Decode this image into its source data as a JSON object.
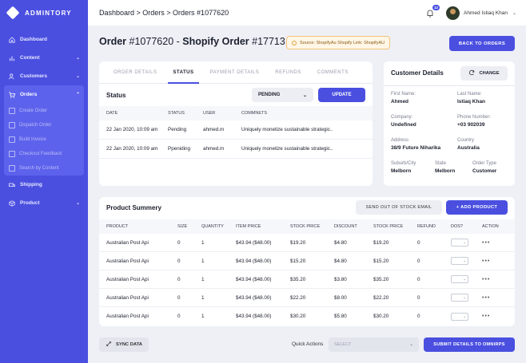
{
  "brand": {
    "name": "ADMINTORY"
  },
  "sidebar": {
    "items": [
      {
        "label": "Dashboard",
        "icon": "home-icon"
      },
      {
        "label": "Content",
        "icon": "bar-chart-icon"
      },
      {
        "label": "Customers",
        "icon": "users-icon"
      },
      {
        "label": "Orders",
        "icon": "cart-icon"
      },
      {
        "label": "Shipping",
        "icon": "truck-icon"
      },
      {
        "label": "Product",
        "icon": "box-icon"
      }
    ],
    "orders_sub": [
      "Create Order",
      "Dispatch Order",
      "Build Invoice",
      "Checkout Feedback",
      "Search by Content"
    ]
  },
  "header": {
    "breadcrumb": "Dashboard > Orders > Orders #1077620",
    "notification_count": "12",
    "user_name": "Ahmed Istiaq Khan"
  },
  "order": {
    "prefix": "Order",
    "number": "#1077620",
    "separator": "-",
    "shopify_label": "Shopify Order",
    "shopify_number": "#17713",
    "source_badge": "Source: ShopifyAu Shopify Link: ShopifyAU",
    "back_label": "BACK TO ORDERS"
  },
  "tabs": [
    "ORDER DETAILS",
    "STATUS",
    "PAYMENT DETAILS",
    "REFUNDS",
    "COMMENTS"
  ],
  "status": {
    "title": "Status",
    "selected": "PENDING",
    "update_label": "UPDATE",
    "columns": [
      "DATE",
      "STATUS",
      "USER",
      "COMMNETS"
    ],
    "rows": [
      [
        "22 Jan 2020, 10:09 am",
        "Pending",
        "ahmed.m",
        "Uniquely monetize sustainable strategic.."
      ],
      [
        "22 Jan 2020, 10:09 am",
        "Ppeniding",
        "ahmed.m",
        "Uniquely monetize sustainable strategic.."
      ]
    ]
  },
  "customer": {
    "title": "Customer Details",
    "change_label": "CHANGE",
    "fields": {
      "first_name": {
        "k": "First Name:",
        "v": "Ahmed"
      },
      "last_name": {
        "k": "Last Name:",
        "v": "Istiaq Khan"
      },
      "company": {
        "k": "Company:",
        "v": "Undefined"
      },
      "phone": {
        "k": "Phone Number:",
        "v": "+03 902039"
      },
      "address": {
        "k": "Address",
        "v": "38/9 Future Niharika"
      },
      "country": {
        "k": "Country",
        "v": "Australia"
      },
      "suburb": {
        "k": "Suburb/City",
        "v": "Melborn"
      },
      "state": {
        "k": "State",
        "v": "Melborn"
      },
      "order_type": {
        "k": "Order Type",
        "v": "Customer"
      }
    }
  },
  "products": {
    "title": "Product Summery",
    "oos_label": "SEND OUT OF STOCK EMAIL",
    "add_label": "+ ADD PRODUCT",
    "columns": [
      "PRODUCT",
      "SIZE",
      "QUANTITY",
      "ITEM PRICE",
      "STOCK PRICE",
      "DISCOUNT",
      "STOCK PRICE",
      "REFUND",
      "DOS?",
      "ACTION"
    ],
    "rows": [
      [
        "Australian Post Api",
        "0",
        "1",
        "$43.94 ($48.00)",
        "$19.20",
        "$4.80",
        "$19.20",
        "0"
      ],
      [
        "Australian Post Api",
        "0",
        "1",
        "$43.94 ($48.00)",
        "$15.20",
        "$4.80",
        "$15.20",
        "0"
      ],
      [
        "Australian Post Api",
        "0",
        "1",
        "$43.94 ($48.00)",
        "$35.20",
        "$3.80",
        "$35.20",
        "0"
      ],
      [
        "Australian Post Api",
        "0",
        "1",
        "$43.94 ($48.00)",
        "$22.20",
        "$8.00",
        "$22.20",
        "0"
      ],
      [
        "Australian Post Api",
        "0",
        "1",
        "$43.94 ($48.00)",
        "$30.20",
        "$5.80",
        "$30.20",
        "0"
      ]
    ]
  },
  "footer": {
    "sync_label": "SYNC DATA",
    "quick_actions_label": "Quick Actions",
    "quick_actions_placeholder": "SELECT",
    "submit_label": "SUBMIT DETAILS TO OMNIRPS"
  },
  "colors": {
    "accent": "#4a4fe0",
    "badge_bg": "#fff6e6",
    "badge_border": "#f3c37a"
  }
}
